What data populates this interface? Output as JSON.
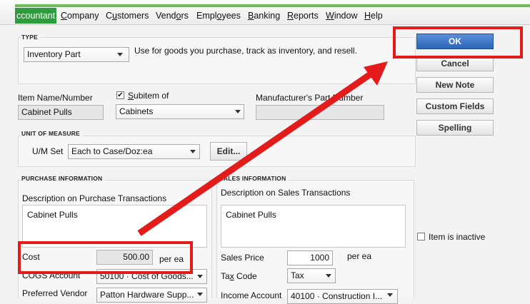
{
  "menu": {
    "active": "ccountant",
    "items": [
      {
        "pre": "",
        "ul": "C",
        "post": "ompany"
      },
      {
        "pre": "C",
        "ul": "u",
        "post": "stomers"
      },
      {
        "pre": "Vend",
        "ul": "o",
        "post": "rs"
      },
      {
        "pre": "Empl",
        "ul": "o",
        "post": "yees"
      },
      {
        "pre": "",
        "ul": "B",
        "post": "anking"
      },
      {
        "pre": "",
        "ul": "R",
        "post": "eports"
      },
      {
        "pre": "",
        "ul": "W",
        "post": "indow"
      },
      {
        "pre": "",
        "ul": "H",
        "post": "elp"
      }
    ]
  },
  "type_section": {
    "legend": "TYPE",
    "selected": "Inventory Part",
    "description": "Use for goods you purchase, track as inventory, and resell."
  },
  "item": {
    "name_label": "Item Name/Number",
    "name_value": "Cabinet Pulls",
    "subitem_label_pre": "",
    "subitem_label_ul": "S",
    "subitem_label_post": "ubitem of",
    "subitem_checked": true,
    "subitem_check_glyph": "✔",
    "subitem_value": "Cabinets",
    "mpn_label": "Manufacturer's Part Number",
    "mpn_value": ""
  },
  "uom": {
    "legend": "UNIT OF MEASURE",
    "set_label": "U/M Set",
    "set_value": "Each to Case/Doz:ea",
    "edit_label": "Edit..."
  },
  "purchase": {
    "legend": "PURCHASE INFORMATION",
    "desc_label": "Description on Purchase Transactions",
    "desc_value": "Cabinet Pulls",
    "cost_label": "Cost",
    "cost_value": "500.00",
    "cost_unit": "per ea",
    "cogs_label": "COGS Account",
    "cogs_value": "50100 · Cost of Goods...",
    "vendor_label": "Preferred Vendor",
    "vendor_value": "Patton Hardware Supp..."
  },
  "sales": {
    "legend": "SALES INFORMATION",
    "desc_label": "Description on Sales Transactions",
    "desc_value": "Cabinet Pulls",
    "price_label": "Sales Price",
    "price_value": "1000",
    "price_unit": "per ea",
    "tax_label_pre": "Ta",
    "tax_label_ul": "x",
    "tax_label_post": " Code",
    "tax_value": "Tax",
    "income_label": "Income Account",
    "income_value": "40100 · Construction I..."
  },
  "buttons": {
    "ok": "OK",
    "cancel": "Cancel",
    "new_note": "New Note",
    "custom_fields": "Custom Fields",
    "spelling_pre": "Spellin",
    "spelling_ul": "g",
    "spelling_post": ""
  },
  "inactive_label": "Item is inactive",
  "inactive_checked": false,
  "annotation_color": "#e31b1b",
  "accent_green": "#2f9b3c",
  "ok_blue": "#2d64b8"
}
